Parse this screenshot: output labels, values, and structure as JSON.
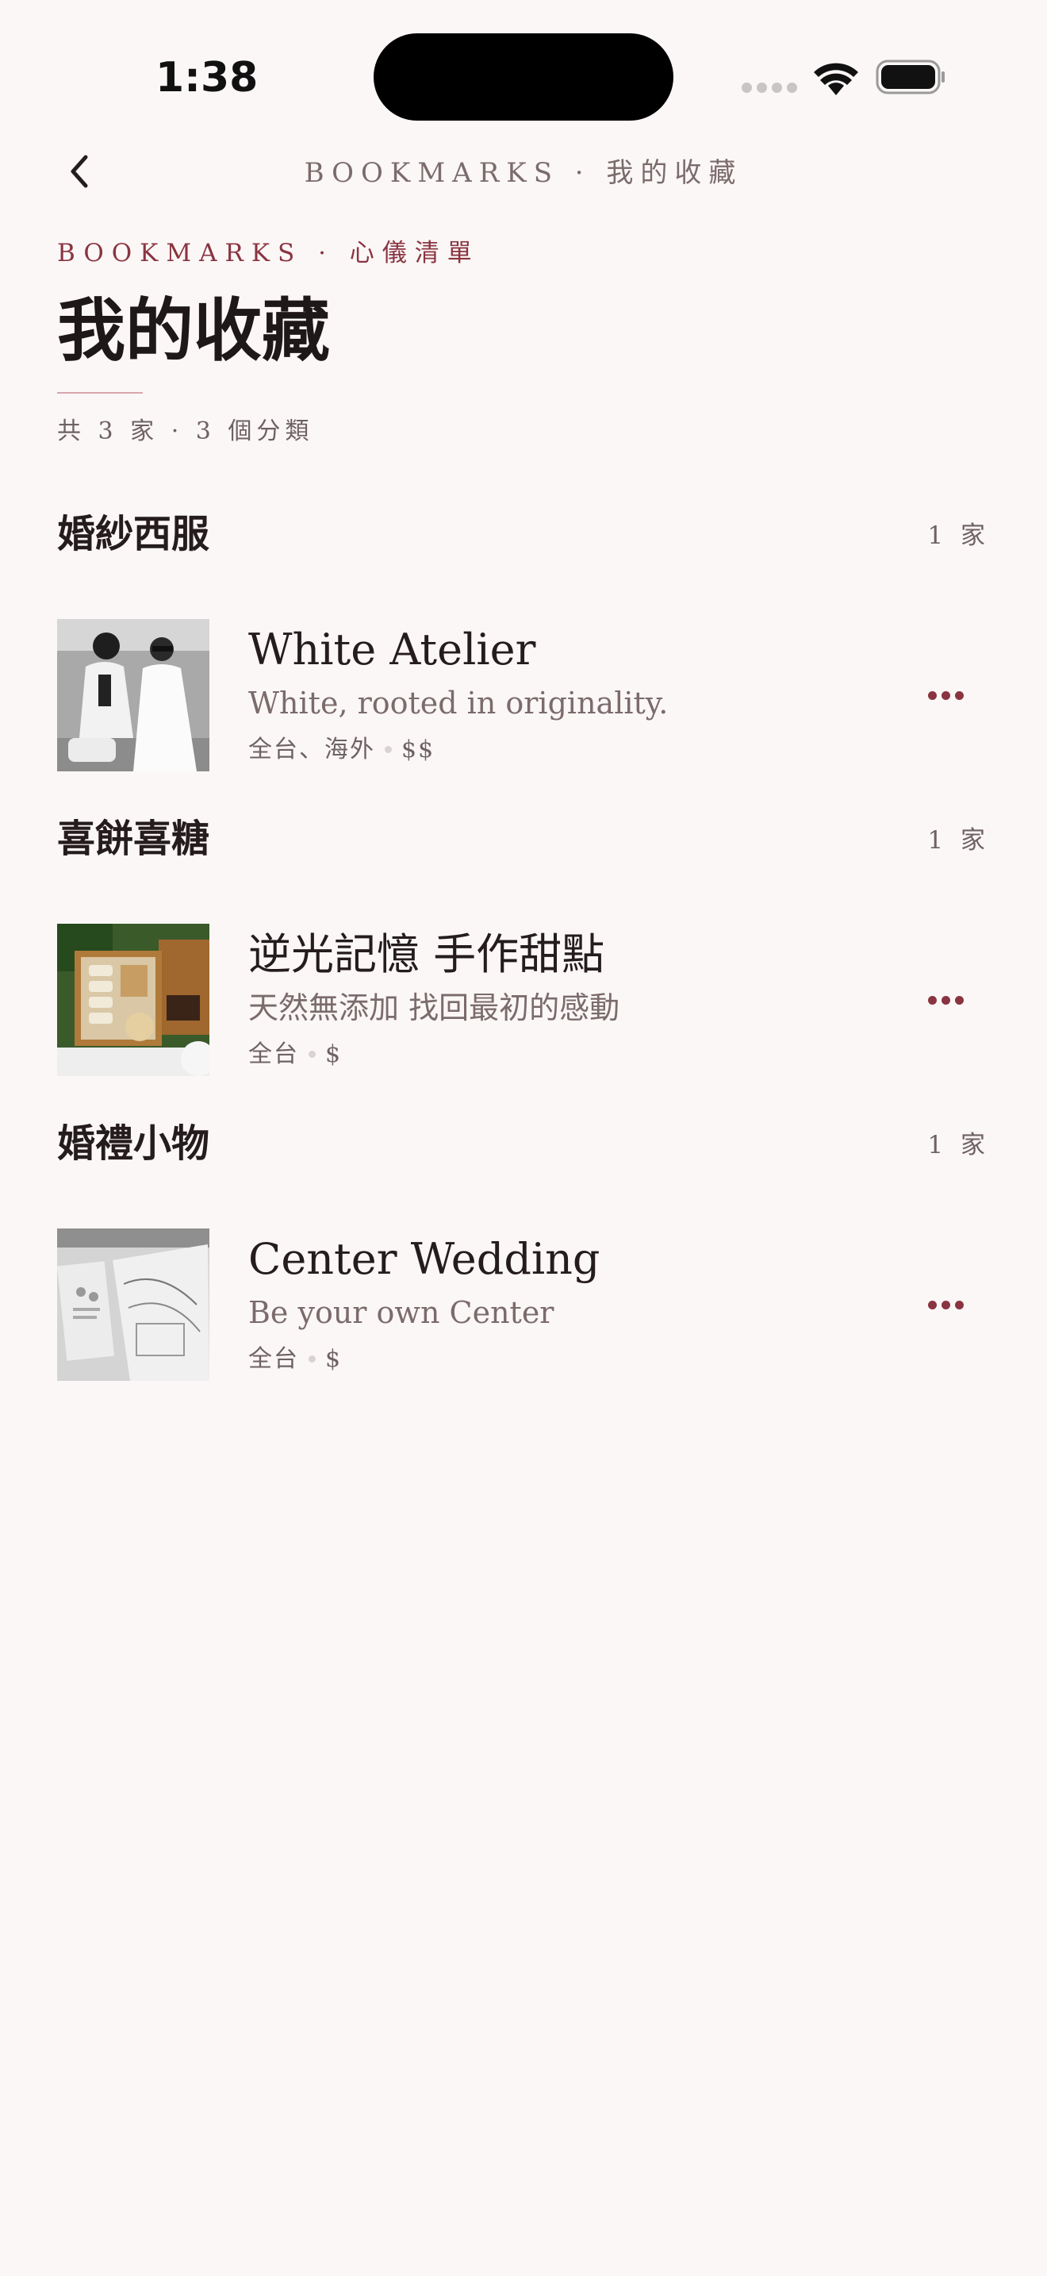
{
  "status_bar": {
    "time": "1:38"
  },
  "nav": {
    "title": "BOOKMARKS · 我的收藏"
  },
  "header": {
    "eyebrow": "BOOKMARKS · 心儀清單",
    "title": "我的收藏",
    "summary": "共 3 家 · 3 個分類"
  },
  "colors": {
    "background": "#fbf7f6",
    "accent": "#8a3441",
    "text_primary": "#241c1d",
    "text_secondary": "#7b6b6d"
  },
  "sections": [
    {
      "title": "婚紗西服",
      "count": "1 家",
      "items": [
        {
          "name": "White Atelier",
          "tagline": "White, rooted in originality.",
          "region": "全台、海外",
          "price": "$$",
          "image_icon": "wedding-couple-photo"
        }
      ]
    },
    {
      "title": "喜餅喜糖",
      "count": "1 家",
      "items": [
        {
          "name": "逆光記憶 手作甜點",
          "tagline": "天然無添加 找回最初的感動",
          "region": "全台",
          "price": "$",
          "image_icon": "pastry-box-photo"
        }
      ]
    },
    {
      "title": "婚禮小物",
      "count": "1 家",
      "items": [
        {
          "name": "Center Wedding",
          "tagline": "Be your own Center",
          "region": "全台",
          "price": "$",
          "image_icon": "wedding-invitation-photo"
        }
      ]
    }
  ]
}
